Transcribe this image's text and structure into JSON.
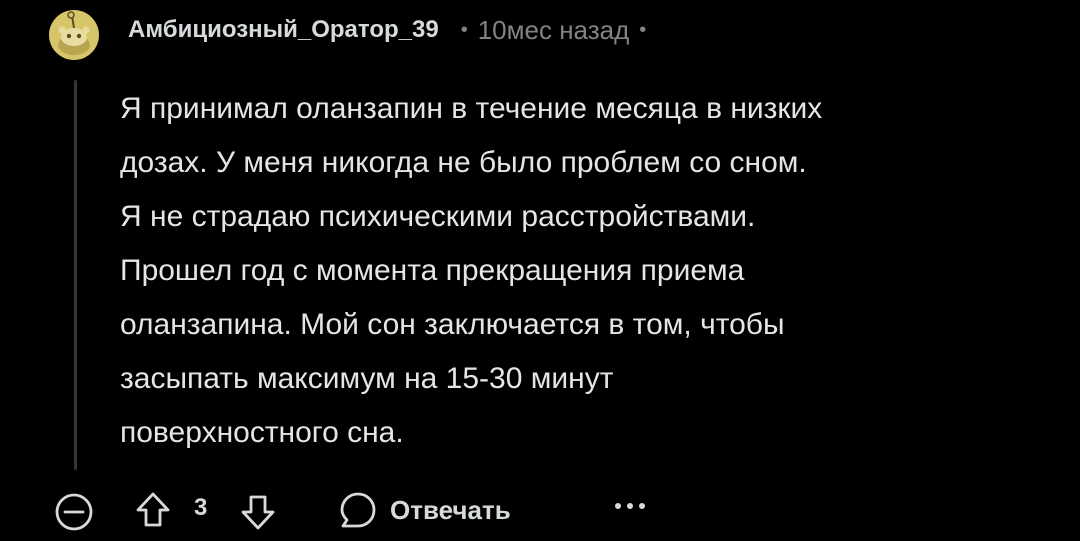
{
  "comment": {
    "username": "Амбициозный_Оратор_39",
    "separator": "•",
    "time_ago": "10мес назад",
    "body_lines": [
      "Я принимал оланзапин в течение месяца в низких",
      "дозах. У меня никогда не было проблем со сном.",
      "Я не страдаю психическими расстройствами.",
      "Прошел год с момента прекращения приема",
      "оланзапина. Мой сон заключается в том, чтобы",
      "засыпать максимум на 15-30 минут",
      "поверхностного сна."
    ]
  },
  "actions": {
    "score": "3",
    "reply_label": "Отвечать"
  },
  "icons": {
    "avatar": "snoo-avatar-icon",
    "collapse": "collapse-icon",
    "upvote": "upvote-arrow-icon",
    "downvote": "downvote-arrow-icon",
    "reply": "speech-bubble-icon",
    "more": "more-options-icon"
  },
  "colors": {
    "background": "#000000",
    "text": "#d7dadc",
    "muted": "#818384",
    "avatar_yellow": "#d7c56a",
    "thread_line": "#343536"
  }
}
